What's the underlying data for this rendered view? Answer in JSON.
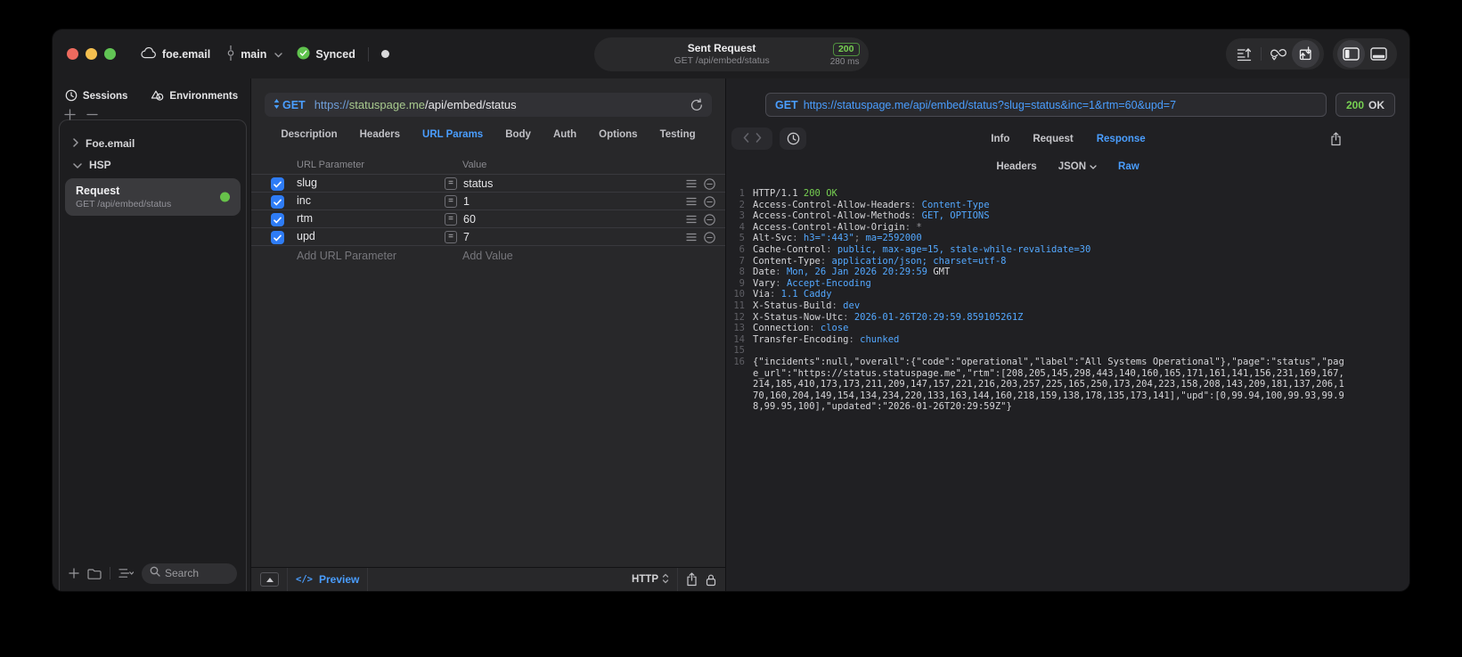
{
  "colors": {
    "accent_blue": "#4a9eff",
    "green": "#77d052",
    "checkbox_blue": "#2e7cf6",
    "mono_blue": "#53a8ff"
  },
  "titlebar": {
    "project": "foe.email",
    "branch": "main",
    "sync_label": "Synced",
    "request_summary": {
      "title": "Sent Request",
      "subtitle": "GET /api/embed/status",
      "status_code": "200",
      "duration": "280 ms"
    },
    "toolbar_icons": [
      "export-lines-icon",
      "sync-loop-icon",
      "import-request-icon",
      "sidebar-layout-icon",
      "bottom-panel-icon"
    ]
  },
  "sidebar": {
    "tabs": [
      {
        "label": "Sessions",
        "icon": "clock-icon"
      },
      {
        "label": "Environments",
        "icon": "environments-icon"
      }
    ],
    "tree": [
      {
        "label": "Foe.email",
        "expanded": false
      },
      {
        "label": "HSP",
        "expanded": true
      }
    ],
    "request": {
      "title": "Request",
      "subtitle": "GET /api/embed/status"
    },
    "search": {
      "placeholder": "Search"
    }
  },
  "request_editor": {
    "method": "GET",
    "url": {
      "protocol": "https://",
      "host": "statuspage.me",
      "path": "/api/embed/status"
    },
    "tabs": [
      "Description",
      "Headers",
      "URL Params",
      "Body",
      "Auth",
      "Options",
      "Testing"
    ],
    "active_tab": "URL Params",
    "params": {
      "columns": [
        "URL Parameter",
        "Value"
      ],
      "rows": [
        {
          "name": "slug",
          "value": "status",
          "enabled": true
        },
        {
          "name": "inc",
          "value": "1",
          "enabled": true
        },
        {
          "name": "rtm",
          "value": "60",
          "enabled": true
        },
        {
          "name": "upd",
          "value": "7",
          "enabled": true
        }
      ],
      "add_parameter_label": "Add URL Parameter",
      "add_value_label": "Add Value"
    },
    "footer": {
      "preview_label": "Preview",
      "code_glyph": "</>",
      "protocol": "HTTP"
    }
  },
  "response_viewer": {
    "request_line": {
      "method": "GET",
      "url": "https://statuspage.me/api/embed/status?slug=status&inc=1&rtm=60&upd=7"
    },
    "status": {
      "code": "200",
      "text": "OK"
    },
    "tabs": [
      "Info",
      "Request",
      "Response"
    ],
    "active_tab": "Response",
    "subtabs": [
      {
        "label": "Headers"
      },
      {
        "label": "JSON",
        "dropdown": true
      },
      {
        "label": "Raw",
        "active": true
      }
    ],
    "body_lines": [
      {
        "num": "1",
        "parts": [
          {
            "text": "HTTP/1.1 ",
            "color": "plain"
          },
          {
            "text": "200 OK",
            "color": "green"
          }
        ]
      },
      {
        "num": "2",
        "parts": [
          {
            "text": "Access-Control-Allow-Headers",
            "color": "plain"
          },
          {
            "text": ": ",
            "color": "dim"
          },
          {
            "text": "Content-Type",
            "color": "blue"
          }
        ]
      },
      {
        "num": "3",
        "parts": [
          {
            "text": "Access-Control-Allow-Methods",
            "color": "plain"
          },
          {
            "text": ": ",
            "color": "dim"
          },
          {
            "text": "GET, OPTIONS",
            "color": "blue"
          }
        ]
      },
      {
        "num": "4",
        "parts": [
          {
            "text": "Access-Control-Allow-Origin",
            "color": "plain"
          },
          {
            "text": ": ",
            "color": "dim"
          },
          {
            "text": "*",
            "color": "dim"
          }
        ]
      },
      {
        "num": "5",
        "parts": [
          {
            "text": "Alt-Svc",
            "color": "plain"
          },
          {
            "text": ": ",
            "color": "dim"
          },
          {
            "text": "h3=\":443\"",
            "color": "blue"
          },
          {
            "text": "; ",
            "color": "dim"
          },
          {
            "text": "ma=2592000",
            "color": "blue"
          }
        ]
      },
      {
        "num": "6",
        "parts": [
          {
            "text": "Cache-Control",
            "color": "plain"
          },
          {
            "text": ": ",
            "color": "dim"
          },
          {
            "text": "public, max-age=15, stale-while-revalidate=30",
            "color": "blue"
          }
        ]
      },
      {
        "num": "7",
        "parts": [
          {
            "text": "Content-Type",
            "color": "plain"
          },
          {
            "text": ": ",
            "color": "dim"
          },
          {
            "text": "application/json; charset=utf-8",
            "color": "blue"
          }
        ]
      },
      {
        "num": "8",
        "parts": [
          {
            "text": "Date",
            "color": "plain"
          },
          {
            "text": ": ",
            "color": "dim"
          },
          {
            "text": "Mon, 26 Jan 2026 20:29:59",
            "color": "blue"
          },
          {
            "text": " GMT",
            "color": "plain"
          }
        ]
      },
      {
        "num": "9",
        "parts": [
          {
            "text": "Vary",
            "color": "plain"
          },
          {
            "text": ": ",
            "color": "dim"
          },
          {
            "text": "Accept-Encoding",
            "color": "blue"
          }
        ]
      },
      {
        "num": "10",
        "parts": [
          {
            "text": "Via",
            "color": "plain"
          },
          {
            "text": ": ",
            "color": "dim"
          },
          {
            "text": "1.1 Caddy",
            "color": "blue"
          }
        ]
      },
      {
        "num": "11",
        "parts": [
          {
            "text": "X-Status-Build",
            "color": "plain"
          },
          {
            "text": ": ",
            "color": "dim"
          },
          {
            "text": "dev",
            "color": "blue"
          }
        ]
      },
      {
        "num": "12",
        "parts": [
          {
            "text": "X-Status-Now-Utc",
            "color": "plain"
          },
          {
            "text": ": ",
            "color": "dim"
          },
          {
            "text": "2026-01-26T20:29:59.859105261Z",
            "color": "blue"
          }
        ]
      },
      {
        "num": "13",
        "parts": [
          {
            "text": "Connection",
            "color": "plain"
          },
          {
            "text": ": ",
            "color": "dim"
          },
          {
            "text": "close",
            "color": "blue"
          }
        ]
      },
      {
        "num": "14",
        "parts": [
          {
            "text": "Transfer-Encoding",
            "color": "plain"
          },
          {
            "text": ": ",
            "color": "dim"
          },
          {
            "text": "chunked",
            "color": "blue"
          }
        ]
      },
      {
        "num": "15",
        "parts": []
      },
      {
        "num": "16",
        "wrap": true,
        "parts": [
          {
            "text": "{\"incidents\":null,\"overall\":{\"code\":\"operational\",\"label\":\"All Systems Operational\"},\"page\":\"status\",\"page_url\":\"https://status.statuspage.me\",\"rtm\":[208,205,145,298,443,140,160,165,171,161,141,156,231,169,167,214,185,410,173,173,211,209,147,157,221,216,203,257,225,165,250,173,204,223,158,208,143,209,181,137,206,170,160,204,149,154,134,234,220,133,163,144,160,218,159,138,178,135,173,141],\"upd\":[0,99.94,100,99.93,99.98,99.95,100],\"updated\":\"2026-01-26T20:29:59Z\"}",
            "color": "plain"
          }
        ]
      }
    ]
  }
}
